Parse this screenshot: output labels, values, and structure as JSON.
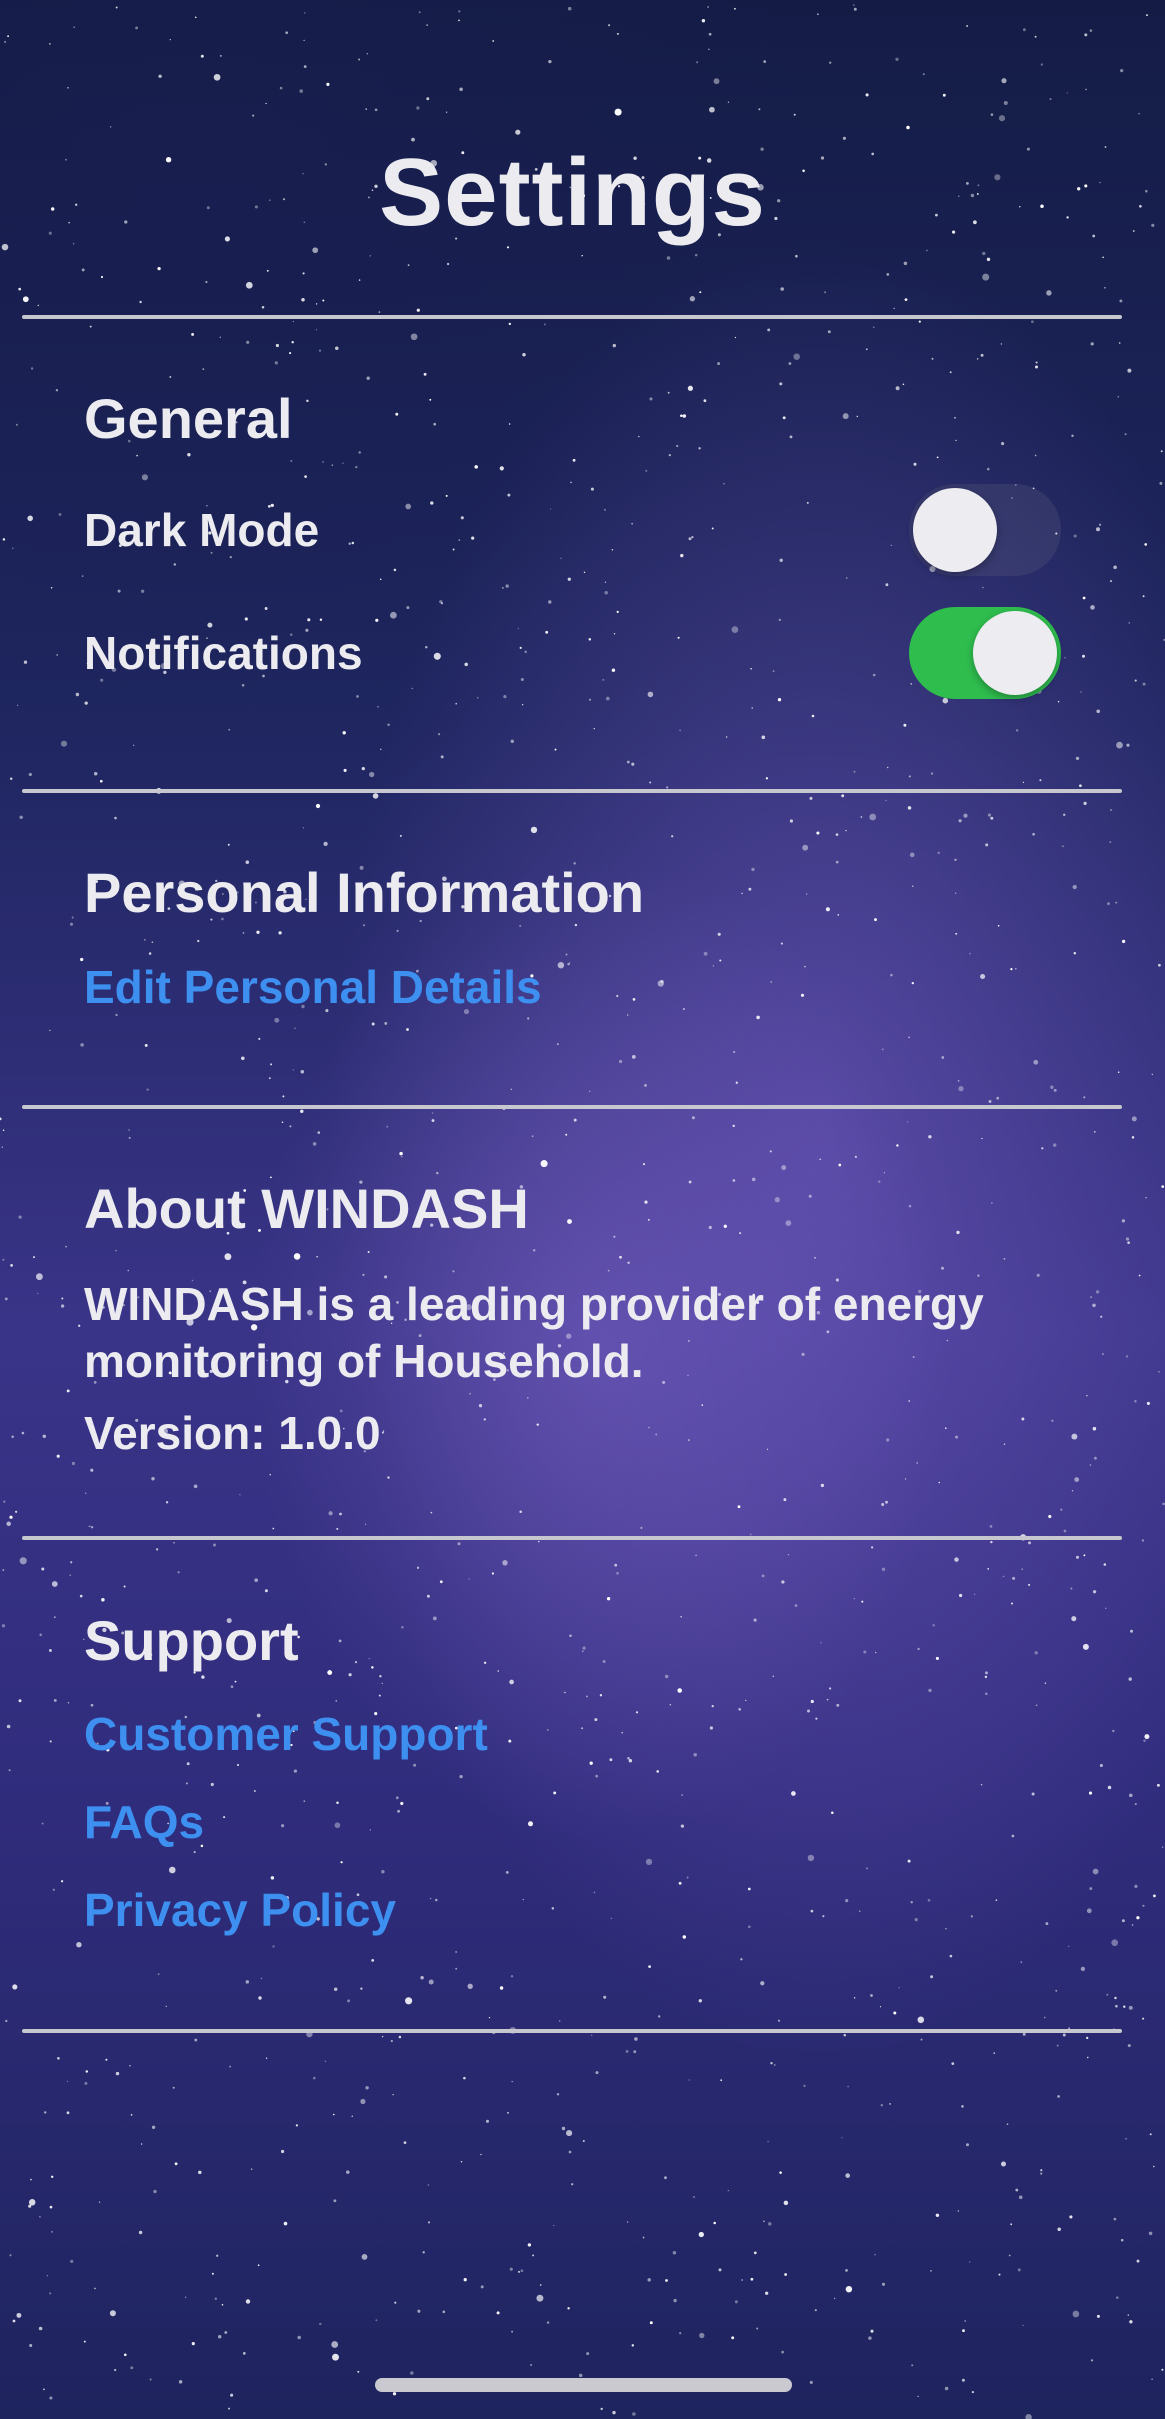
{
  "page": {
    "title": "Settings"
  },
  "general": {
    "title": "General",
    "dark_mode": {
      "label": "Dark Mode",
      "enabled": false
    },
    "notifications": {
      "label": "Notifications",
      "enabled": true
    }
  },
  "personal_information": {
    "title": "Personal Information",
    "edit_link": "Edit Personal Details"
  },
  "about": {
    "title": "About WINDASH",
    "description": "WINDASH is a leading provider of energy monitoring of Household.",
    "version": "Version: 1.0.0"
  },
  "support": {
    "title": "Support",
    "links": [
      "Customer Support",
      "FAQs",
      "Privacy Policy"
    ]
  },
  "colors": {
    "text": "#ebebf0",
    "link": "#3d8ff0",
    "toggle_on": "#2fbd4e",
    "divider": "#c7c7cf"
  }
}
